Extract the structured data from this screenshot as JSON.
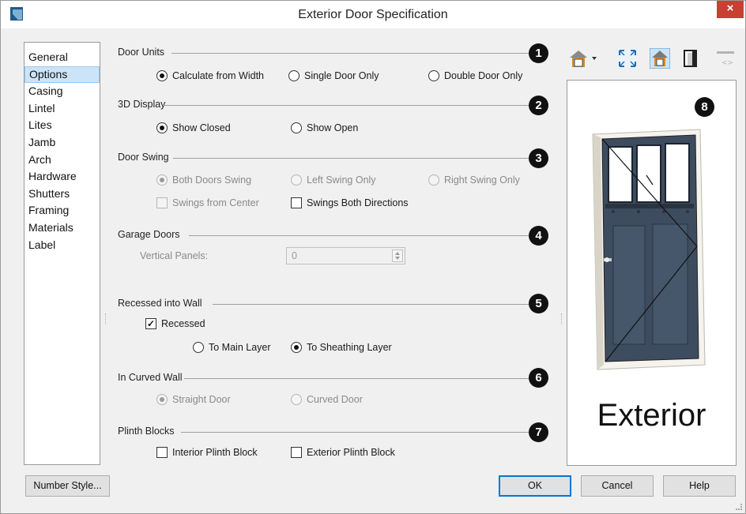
{
  "window": {
    "title": "Exterior Door Specification",
    "close_glyph": "×"
  },
  "nav": {
    "items": [
      "General",
      "Options",
      "Casing",
      "Lintel",
      "Lites",
      "Jamb",
      "Arch",
      "Hardware",
      "Shutters",
      "Framing",
      "Materials",
      "Label"
    ],
    "selected": "Options"
  },
  "sections": {
    "door_units": {
      "title": "Door Units",
      "badge": "1",
      "options": [
        {
          "label": "Calculate from Width",
          "checked": true
        },
        {
          "label": "Single Door Only",
          "checked": false
        },
        {
          "label": "Double Door Only",
          "checked": false
        }
      ]
    },
    "display_3d": {
      "title": "3D Display",
      "badge": "2",
      "options": [
        {
          "label": "Show Closed",
          "checked": true
        },
        {
          "label": "Show Open",
          "checked": false
        }
      ]
    },
    "door_swing": {
      "title": "Door Swing",
      "badge": "3",
      "options": [
        {
          "label": "Both Doors Swing",
          "checked": true,
          "enabled": false
        },
        {
          "label": "Left Swing Only",
          "checked": false,
          "enabled": false
        },
        {
          "label": "Right Swing Only",
          "checked": false,
          "enabled": false
        }
      ],
      "swings_from_center": {
        "label": "Swings from Center",
        "checked": false,
        "enabled": false
      },
      "swings_both_directions": {
        "label": "Swings Both Directions",
        "checked": false,
        "enabled": true
      }
    },
    "garage_doors": {
      "title": "Garage Doors",
      "badge": "4",
      "vertical_panels_label": "Vertical Panels:",
      "vertical_panels_value": "0"
    },
    "recessed": {
      "title": "Recessed into Wall",
      "badge": "5",
      "recessed": {
        "label": "Recessed",
        "checked": true,
        "mark": "✓"
      },
      "options": [
        {
          "label": "To Main Layer",
          "checked": false
        },
        {
          "label": "To Sheathing Layer",
          "checked": true
        }
      ]
    },
    "curved_wall": {
      "title": "In Curved Wall",
      "badge": "6",
      "options": [
        {
          "label": "Straight Door",
          "checked": true,
          "enabled": false
        },
        {
          "label": "Curved Door",
          "checked": false,
          "enabled": false
        }
      ]
    },
    "plinth": {
      "title": "Plinth Blocks",
      "badge": "7",
      "interior": {
        "label": "Interior Plinth Block",
        "checked": false
      },
      "exterior": {
        "label": "Exterior Plinth Block",
        "checked": false
      }
    }
  },
  "preview": {
    "badge": "8",
    "label": "Exterior"
  },
  "toolbar": {
    "icons": [
      "3d-view-mode-icon",
      "fit-to-window-icon",
      "render-view-icon",
      "door-profile-icon",
      "reset-view-icon"
    ]
  },
  "buttons": {
    "number_style": "Number Style...",
    "ok": "OK",
    "cancel": "Cancel",
    "help": "Help"
  },
  "colors": {
    "door_panel": "#3d4c5e",
    "close_button": "#c84031",
    "selection": "#cce4f7",
    "badge": "#111111"
  }
}
